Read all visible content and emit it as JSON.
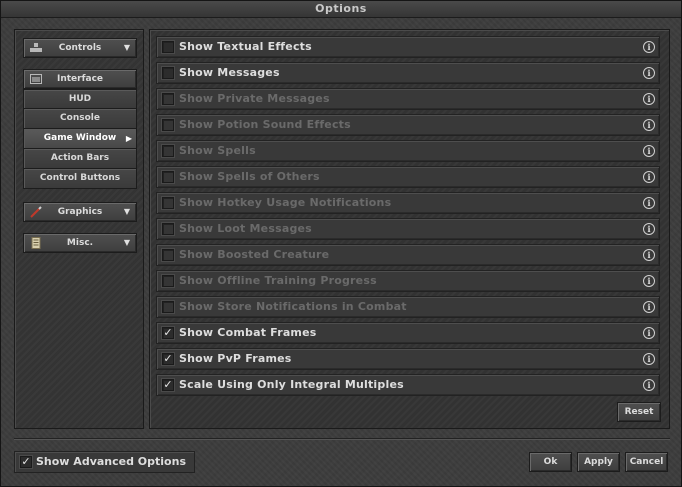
{
  "window": {
    "title": "Options"
  },
  "sidebar": {
    "sections": [
      {
        "label": "Controls",
        "icon": "controls-icon",
        "expanded": false
      },
      {
        "label": "Interface",
        "icon": "interface-icon",
        "expanded": true
      },
      {
        "label": "Graphics",
        "icon": "graphics-icon",
        "expanded": false
      },
      {
        "label": "Misc.",
        "icon": "misc-icon",
        "expanded": false
      }
    ],
    "interface_items": [
      {
        "label": "HUD"
      },
      {
        "label": "Console"
      },
      {
        "label": "Game Window",
        "selected": true
      },
      {
        "label": "Action Bars"
      },
      {
        "label": "Control Buttons"
      }
    ]
  },
  "options": [
    {
      "label": "Show Textual Effects",
      "checked": false,
      "enabled": true
    },
    {
      "label": "Show Messages",
      "checked": false,
      "enabled": true
    },
    {
      "label": "Show Private Messages",
      "checked": false,
      "enabled": false
    },
    {
      "label": "Show Potion Sound Effects",
      "checked": false,
      "enabled": false
    },
    {
      "label": "Show Spells",
      "checked": false,
      "enabled": false
    },
    {
      "label": "Show Spells of Others",
      "checked": false,
      "enabled": false
    },
    {
      "label": "Show Hotkey Usage Notifications",
      "checked": false,
      "enabled": false
    },
    {
      "label": "Show Loot Messages",
      "checked": false,
      "enabled": false
    },
    {
      "label": "Show Boosted Creature",
      "checked": false,
      "enabled": false
    },
    {
      "label": "Show Offline Training Progress",
      "checked": false,
      "enabled": false
    },
    {
      "label": "Show Store Notifications in Combat",
      "checked": false,
      "enabled": false
    },
    {
      "label": "Show Combat Frames",
      "checked": true,
      "enabled": true
    },
    {
      "label": "Show PvP Frames",
      "checked": true,
      "enabled": true
    },
    {
      "label": "Scale Using Only Integral Multiples",
      "checked": true,
      "enabled": true
    }
  ],
  "info_glyph": "i",
  "check_glyph": "✓",
  "buttons": {
    "reset": "Reset",
    "ok": "Ok",
    "apply": "Apply",
    "cancel": "Cancel"
  },
  "advanced": {
    "label": "Show Advanced Options",
    "checked": true
  }
}
